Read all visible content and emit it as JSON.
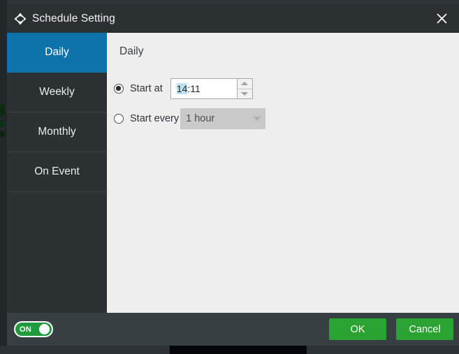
{
  "window": {
    "title": "Schedule Setting",
    "move_icon": "move-arrows-icon",
    "close_icon": "close-icon"
  },
  "sidebar": {
    "items": [
      {
        "label": "Daily",
        "active": true
      },
      {
        "label": "Weekly",
        "active": false
      },
      {
        "label": "Monthly",
        "active": false
      },
      {
        "label": "On Event",
        "active": false
      }
    ]
  },
  "content": {
    "title": "Daily",
    "start_at": {
      "label": "Start at",
      "selected": true,
      "time_value": "14:11",
      "time_value_selected_part": "14",
      "time_value_rest": ":11",
      "spinner_up_icon": "chevron-up-icon",
      "spinner_down_icon": "chevron-down-icon"
    },
    "start_every": {
      "label": "Start every",
      "selected": false,
      "interval_value": "1 hour",
      "dropdown_icon": "chevron-down-icon",
      "disabled": true
    }
  },
  "footer": {
    "toggle": {
      "label": "ON",
      "state": "on"
    },
    "ok_label": "OK",
    "cancel_label": "Cancel"
  },
  "colors": {
    "accent_blue": "#0e72ab",
    "panel_dark": "#2b3033",
    "footer_dark": "#373f42",
    "content_bg": "#eeeeee",
    "green": "#2aa332",
    "toggle_green": "#1f9b3c"
  }
}
